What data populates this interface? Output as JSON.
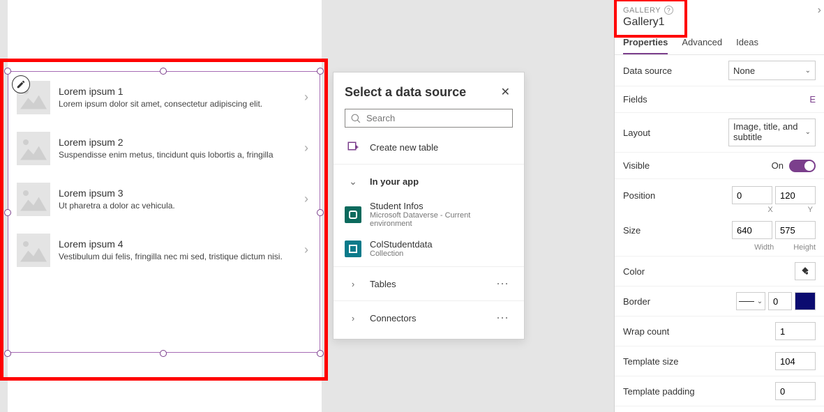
{
  "panel": {
    "type_label": "GALLERY",
    "name": "Gallery1",
    "tabs": {
      "properties": "Properties",
      "advanced": "Advanced",
      "ideas": "Ideas"
    },
    "rows": {
      "data_source": {
        "label": "Data source",
        "value": "None"
      },
      "fields": {
        "label": "Fields",
        "value": "E"
      },
      "layout": {
        "label": "Layout",
        "value": "Image, title, and subtitle"
      },
      "visible": {
        "label": "Visible",
        "value": "On"
      },
      "position": {
        "label": "Position",
        "x": "0",
        "y": "120",
        "xl": "X",
        "yl": "Y"
      },
      "size": {
        "label": "Size",
        "w": "640",
        "h": "575",
        "wl": "Width",
        "hl": "Height"
      },
      "color": {
        "label": "Color"
      },
      "border": {
        "label": "Border",
        "width": "0"
      },
      "wrap_count": {
        "label": "Wrap count",
        "value": "1"
      },
      "template_size": {
        "label": "Template size",
        "value": "104"
      },
      "template_padding": {
        "label": "Template padding",
        "value": "0"
      }
    }
  },
  "flyout": {
    "title": "Select a data source",
    "search_placeholder": "Search",
    "create_new": "Create new table",
    "section_app": "In your app",
    "sources": [
      {
        "title": "Student Infos",
        "sub": "Microsoft Dataverse - Current environment"
      },
      {
        "title": "ColStudentdata",
        "sub": "Collection"
      }
    ],
    "tables": "Tables",
    "connectors": "Connectors"
  },
  "gallery_items": [
    {
      "title": "Lorem ipsum 1",
      "sub": "Lorem ipsum dolor sit amet, consectetur adipiscing elit."
    },
    {
      "title": "Lorem ipsum 2",
      "sub": "Suspendisse enim metus, tincidunt quis lobortis a, fringilla"
    },
    {
      "title": "Lorem ipsum 3",
      "sub": "Ut pharetra a dolor ac vehicula."
    },
    {
      "title": "Lorem ipsum 4",
      "sub": "Vestibulum dui felis, fringilla nec mi sed, tristique dictum nisi."
    }
  ]
}
